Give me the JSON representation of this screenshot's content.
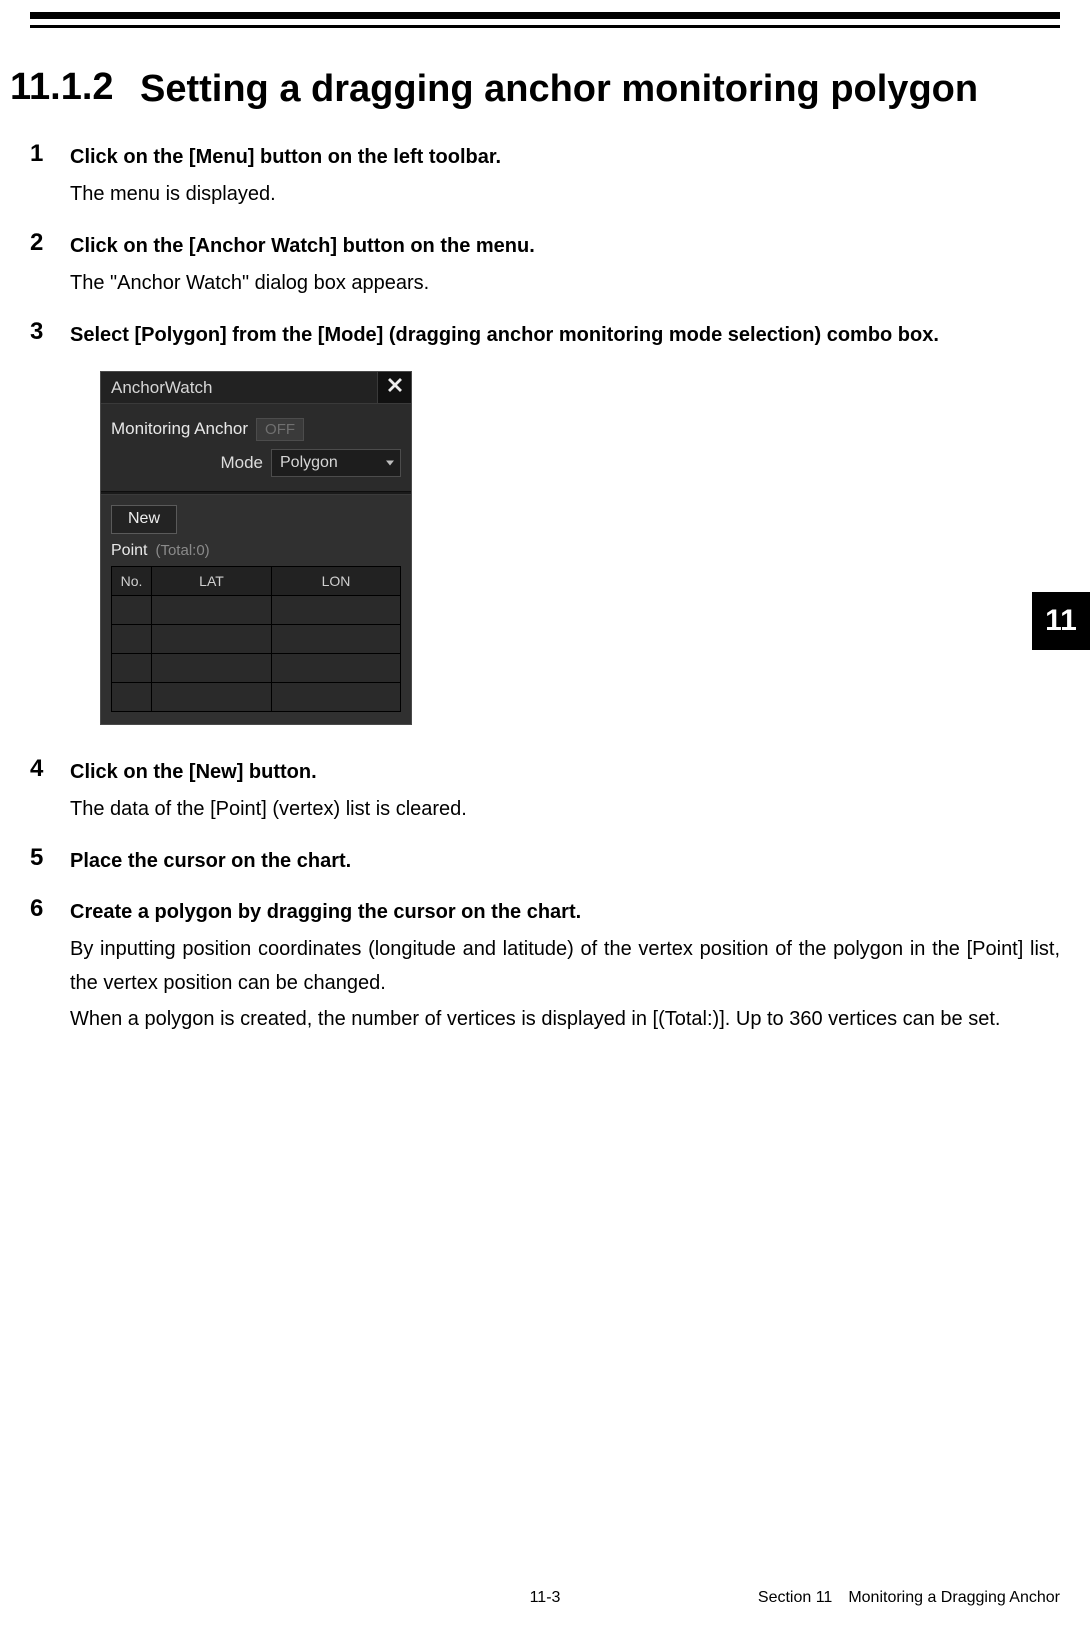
{
  "heading": {
    "number": "11.1.2",
    "title": "Setting a dragging anchor monitoring polygon"
  },
  "steps": [
    {
      "num": "1",
      "title": "Click on the [Menu] button on the left toolbar.",
      "desc": [
        "The menu is displayed."
      ]
    },
    {
      "num": "2",
      "title": "Click on the [Anchor Watch] button on the menu.",
      "desc": [
        "The \"Anchor Watch\" dialog box appears."
      ]
    },
    {
      "num": "3",
      "title": "Select [Polygon] from the [Mode] (dragging anchor monitoring mode selection) combo box.",
      "desc": []
    }
  ],
  "dialog": {
    "title": "AnchorWatch",
    "monitor_label": "Monitoring Anchor",
    "off_badge": "OFF",
    "mode_label": "Mode",
    "mode_value": "Polygon",
    "new_label": "New",
    "point_label": "Point",
    "total_label": "(Total:0)",
    "columns": {
      "no": "No.",
      "lat": "LAT",
      "lon": "LON"
    }
  },
  "steps_after": [
    {
      "num": "4",
      "title": "Click on the [New] button.",
      "desc": [
        "The data of the [Point] (vertex) list is cleared."
      ]
    },
    {
      "num": "5",
      "title": "Place the cursor on the chart.",
      "desc": []
    },
    {
      "num": "6",
      "title": "Create a polygon by dragging the cursor on the chart.",
      "desc": [
        "By inputting position coordinates (longitude and latitude) of the vertex position of the polygon in the [Point] list, the vertex position can be changed.",
        "When a polygon is created, the number of vertices is displayed in [(Total:)]. Up to 360 vertices can be set."
      ]
    }
  ],
  "side_tab": "11",
  "footer": {
    "page": "11-3",
    "section": "Section 11 Monitoring a Dragging Anchor"
  }
}
